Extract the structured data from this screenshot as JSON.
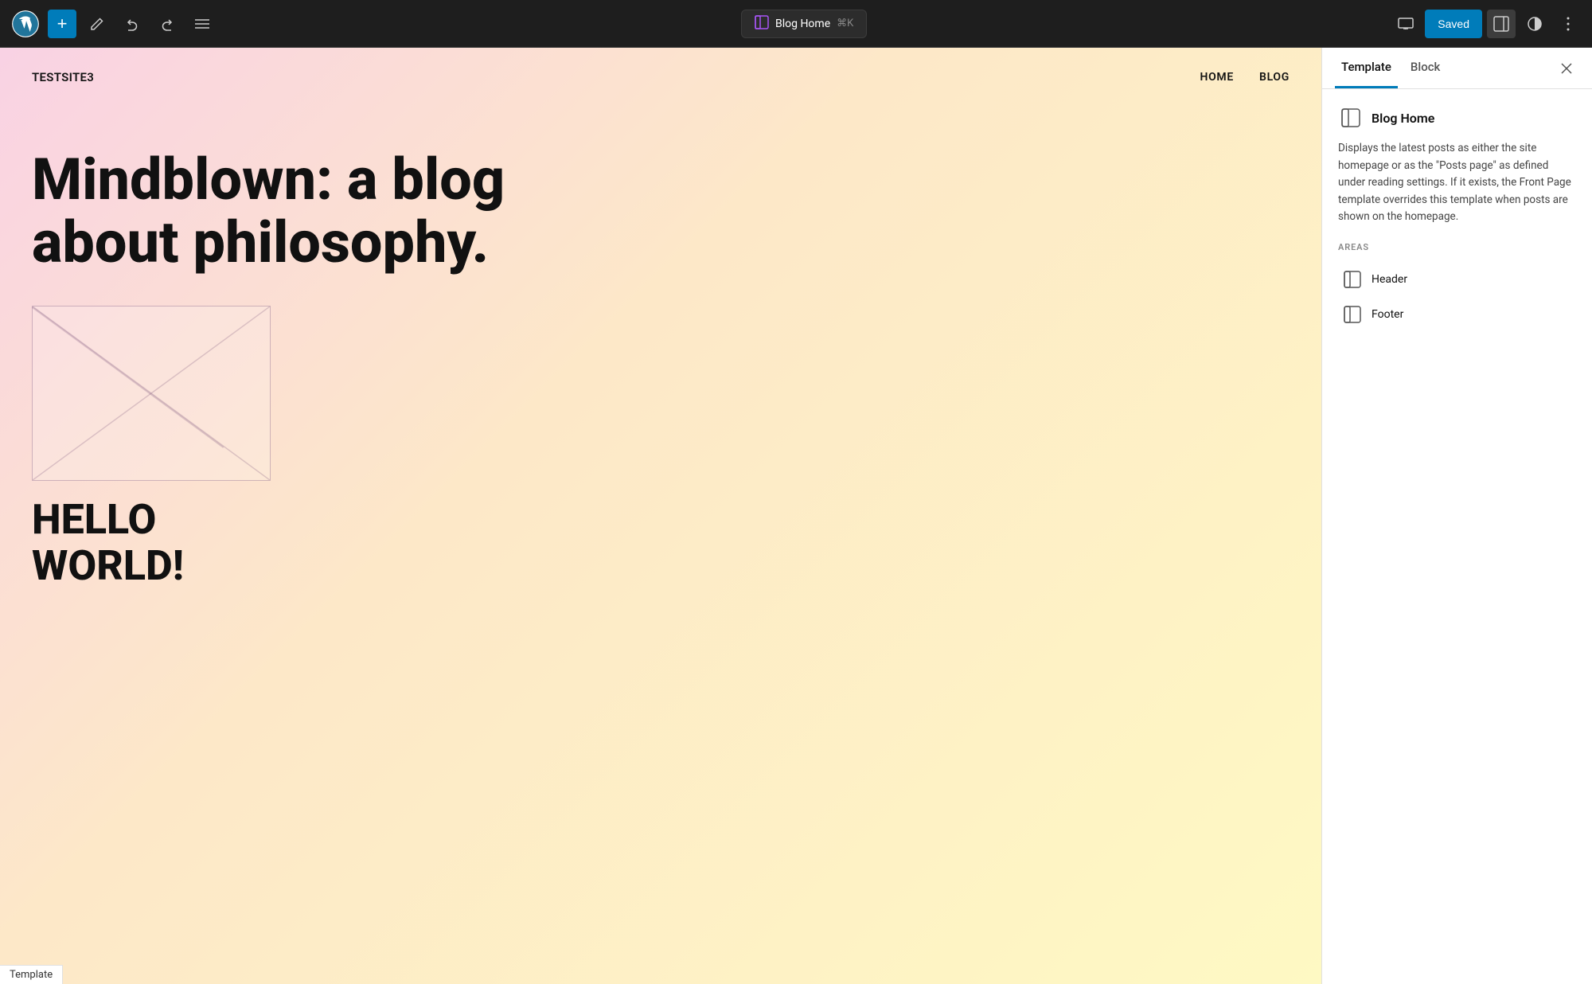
{
  "topbar": {
    "add_label": "+",
    "undo_label": "↩",
    "redo_label": "↪",
    "list_view_label": "☰",
    "template_name": "Blog Home",
    "shortcut": "⌘K",
    "view_desktop_label": "□",
    "sidebar_toggle_label": "▣",
    "contrast_label": "◑",
    "more_label": "⋮",
    "saved_label": "Saved"
  },
  "canvas": {
    "site_title": "TESTSITE3",
    "nav_items": [
      "HOME",
      "BLOG"
    ],
    "hero_title": "Mindblown: a blog about philosophy.",
    "footer_heading_line1": "HELLO",
    "footer_heading_line2": "WORLD!",
    "bottom_label": "Template"
  },
  "sidebar": {
    "tab_template": "Template",
    "tab_block": "Block",
    "template_icon": "⊞",
    "template_name": "Blog Home",
    "template_description": "Displays the latest posts as either the site homepage or as the \"Posts page\" as defined under reading settings. If it exists, the Front Page template overrides this template when posts are shown on the homepage.",
    "areas_label": "AREAS",
    "areas": [
      {
        "name": "Header",
        "icon": "⊞"
      },
      {
        "name": "Footer",
        "icon": "⊞"
      }
    ]
  }
}
